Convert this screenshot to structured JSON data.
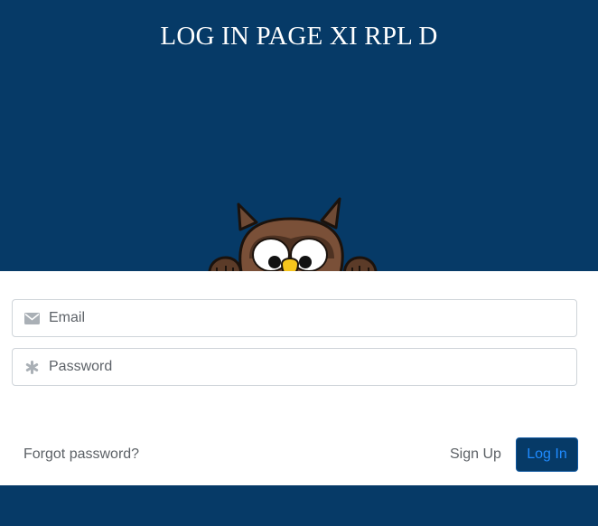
{
  "header": {
    "title": "LOG IN PAGE XI RPL D"
  },
  "mascot": {
    "icon": "owl-mascot"
  },
  "form": {
    "email": {
      "placeholder": "Email",
      "value": "",
      "icon": "envelope-icon"
    },
    "password": {
      "placeholder": "Password",
      "value": "",
      "icon": "asterisk-icon"
    }
  },
  "actions": {
    "forgot_label": "Forgot password?",
    "signup_label": "Sign Up",
    "login_label": "Log In"
  },
  "colors": {
    "background": "#063a67",
    "card": "#ffffff",
    "login_text": "#1f8bff"
  }
}
